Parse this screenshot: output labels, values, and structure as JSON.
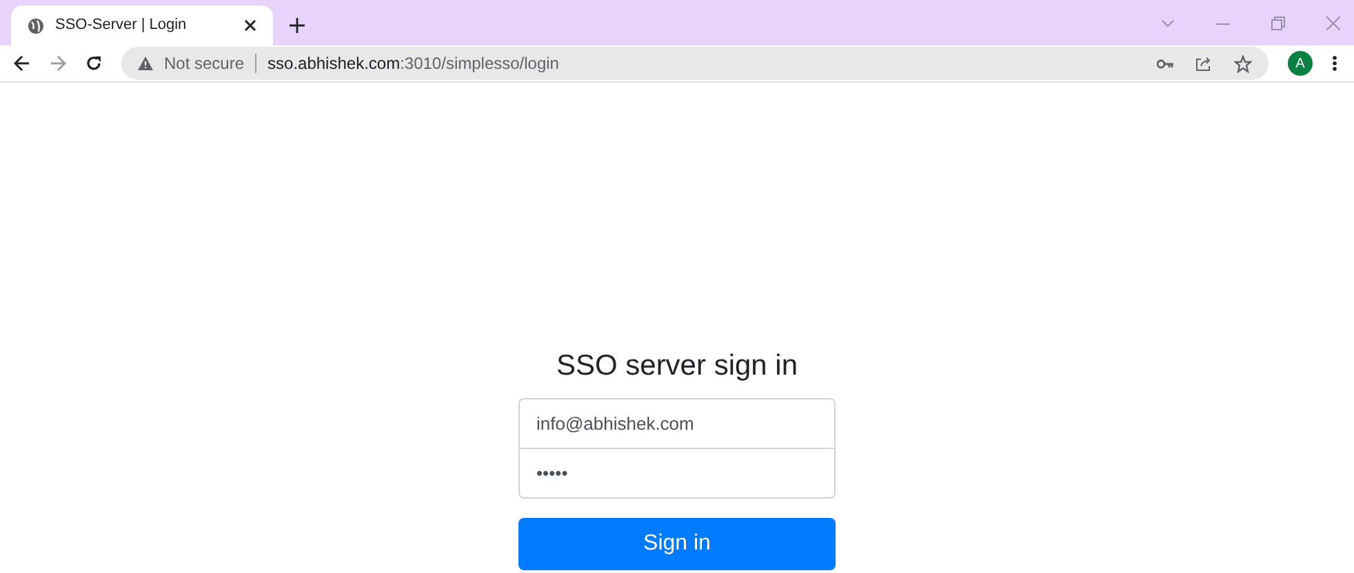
{
  "browser": {
    "tab": {
      "title": "SSO-Server | Login",
      "selected": true
    },
    "address_bar": {
      "security": "Not secure",
      "host": "sso.abhishek.com",
      "path": ":3010/simplesso/login"
    },
    "profile": "A"
  },
  "form": {
    "heading": "SSO server sign in",
    "email": {
      "value": "info@abhishek.com"
    },
    "password": {
      "value": "•••••"
    },
    "button": "Sign in"
  }
}
